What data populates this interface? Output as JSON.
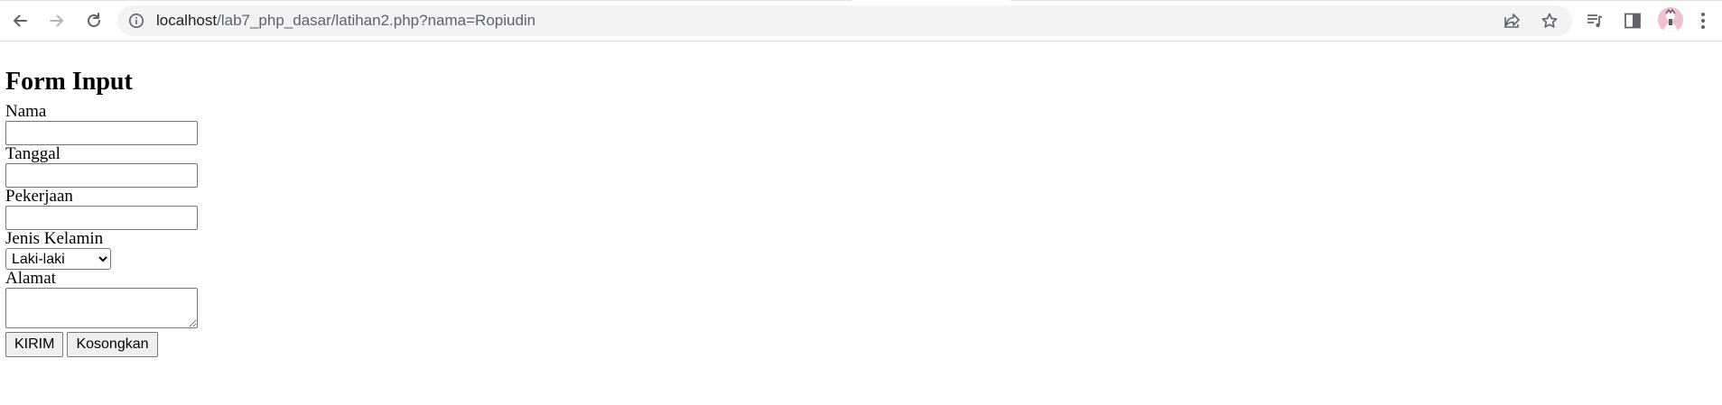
{
  "browser": {
    "url_host": "localhost",
    "url_path": "/lab7_php_dasar/latihan2.php?nama=Ropiudin",
    "icons": {
      "back": "arrow-left-icon",
      "forward": "arrow-right-icon",
      "reload": "reload-icon",
      "site_info": "info-icon",
      "share": "share-icon",
      "bookmark": "star-icon",
      "media": "media-queue-icon",
      "side_panel": "side-panel-icon",
      "profile": "avatar",
      "menu": "kebab-menu-icon"
    }
  },
  "form": {
    "title": "Form Input",
    "nama_label": "Nama",
    "nama_value": "",
    "tanggal_label": "Tanggal",
    "tanggal_value": "",
    "pekerjaan_label": "Pekerjaan",
    "pekerjaan_value": "",
    "jenis_kelamin_label": "Jenis Kelamin",
    "jenis_kelamin_selected": "Laki-laki",
    "alamat_label": "Alamat",
    "alamat_value": "",
    "submit_label": "KIRIM",
    "reset_label": "Kosongkan"
  },
  "colors": {
    "toolbar_icon": "#5f6368",
    "omnibox_bg": "#f1f3f4",
    "input_border": "#767676",
    "button_bg": "#efefef"
  }
}
